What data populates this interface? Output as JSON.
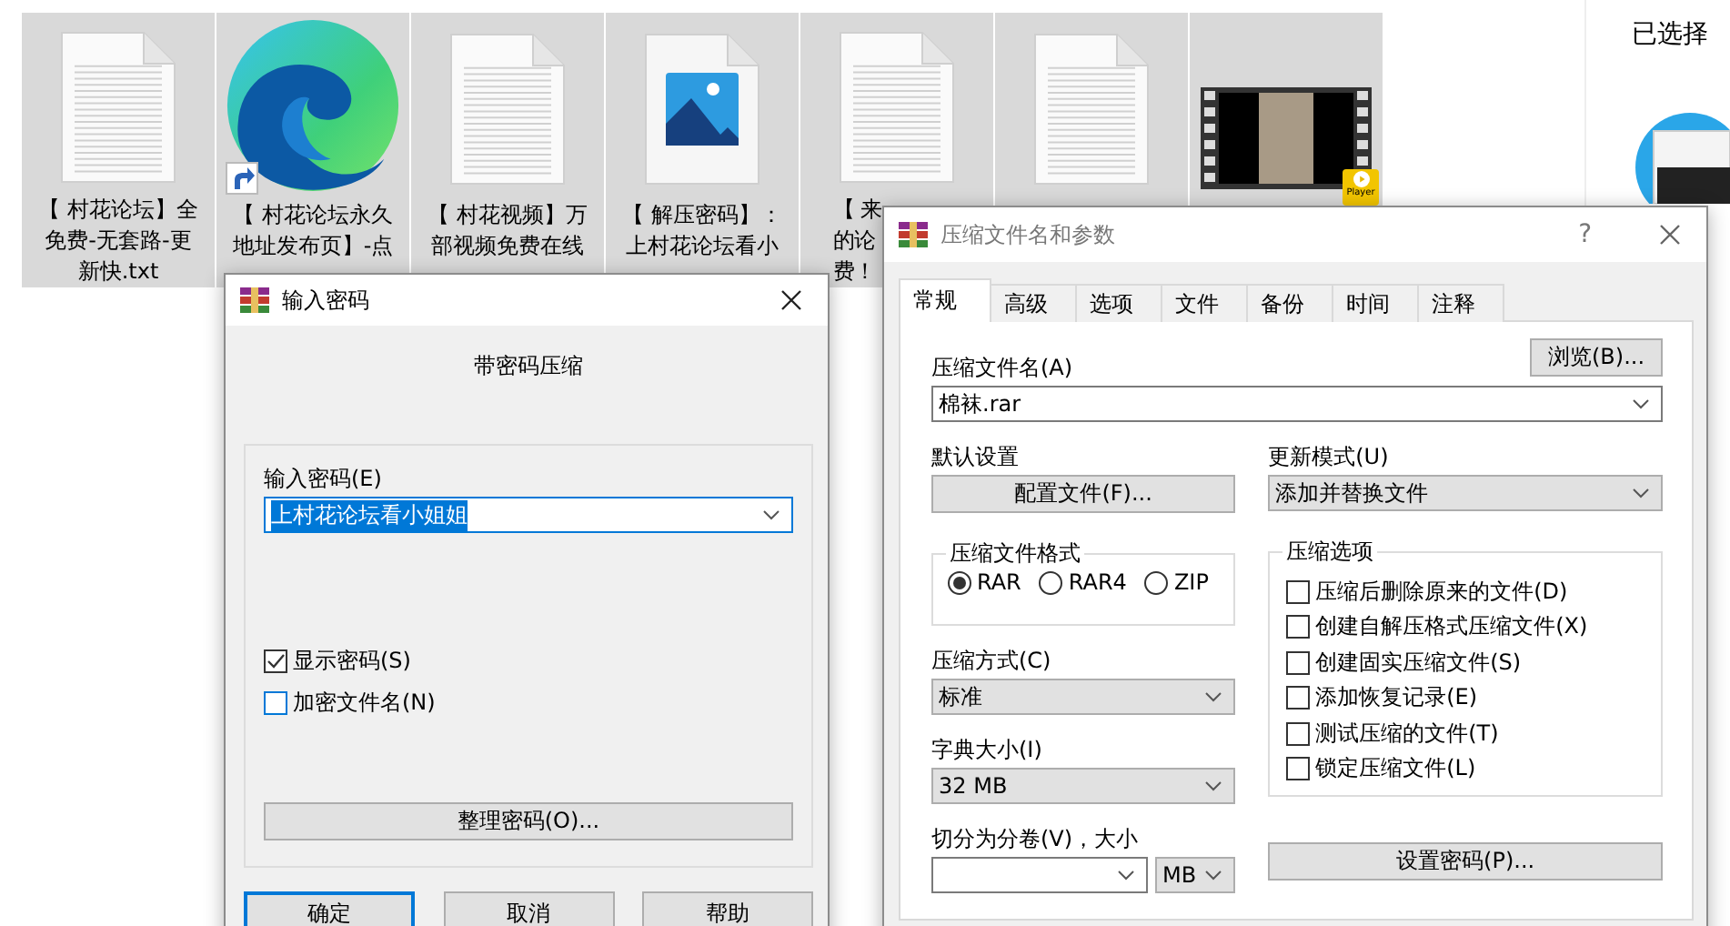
{
  "file_tiles": [
    {
      "kind": "document",
      "label_lines": [
        "【 村花论坛】全",
        "免费-无套路-更",
        "新快.txt"
      ]
    },
    {
      "kind": "shortcut",
      "label_lines": [
        "【 村花论坛永久",
        "地址发布页】-点"
      ]
    },
    {
      "kind": "document",
      "label_lines": [
        "【 村花视频】万",
        "部视频免费在线"
      ]
    },
    {
      "kind": "image",
      "label_lines": [
        "【 解压密码】：",
        "上村花论坛看小"
      ]
    },
    {
      "kind": "document",
      "label_cut_right": true,
      "label_lines": [
        "【 来",
        "的论",
        "费！"
      ]
    },
    {
      "kind": "document"
    },
    {
      "kind": "video",
      "badge": "Player"
    }
  ],
  "preview_pane": {
    "title": "已选择"
  },
  "password_dialog": {
    "title": "输入密码",
    "heading": "带密码压缩",
    "password_label": "输入密码(E)",
    "password_value": "上村花论坛看小姐姐",
    "value_selected": true,
    "options": [
      {
        "label": "显示密码(S)",
        "checked": true
      },
      {
        "label": "加密文件名(N)",
        "checked": false
      }
    ],
    "organize_button": "整理密码(O)...",
    "buttons": [
      {
        "label": "确定",
        "default": true
      },
      {
        "label": "取消",
        "default": false
      },
      {
        "label": "帮助",
        "default": false
      }
    ]
  },
  "archive_dialog": {
    "title": "压缩文件名和参数",
    "help": "?",
    "tabs": [
      {
        "label": "常规",
        "selected": true
      },
      {
        "label": "高级",
        "selected": false
      },
      {
        "label": "选项",
        "selected": false
      },
      {
        "label": "文件",
        "selected": false
      },
      {
        "label": "备份",
        "selected": false
      },
      {
        "label": "时间",
        "selected": false
      },
      {
        "label": "注释",
        "selected": false
      }
    ],
    "archive_name_label": "压缩文件名(A)",
    "browse_button": "浏览(B)...",
    "archive_name": "棉袜.rar",
    "default_settings_label": "默认设置",
    "profiles_button": "配置文件(F)...",
    "update_mode_label": "更新模式(U)",
    "update_mode": "添加并替换文件",
    "format_group": {
      "title": "压缩文件格式",
      "formats": [
        {
          "label": "RAR",
          "selected": true
        },
        {
          "label": "RAR4",
          "selected": false
        },
        {
          "label": "ZIP",
          "selected": false
        }
      ]
    },
    "method_label": "压缩方式(C)",
    "method": "标准",
    "dictionary_label": "字典大小(I)",
    "dictionary": "32 MB",
    "split_label": "切分为分卷(V)，大小",
    "split_unit": "MB",
    "options_group": {
      "title": "压缩选项",
      "options": [
        {
          "label": "压缩后删除原来的文件(D)",
          "checked": false
        },
        {
          "label": "创建自解压格式压缩文件(X)",
          "checked": false
        },
        {
          "label": "创建固实压缩文件(S)",
          "checked": false
        },
        {
          "label": "添加恢复记录(E)",
          "checked": false
        },
        {
          "label": "测试压缩的文件(T)",
          "checked": false
        },
        {
          "label": "锁定压缩文件(L)",
          "checked": false
        }
      ]
    },
    "set_password_button": "设置密码(P)..."
  }
}
